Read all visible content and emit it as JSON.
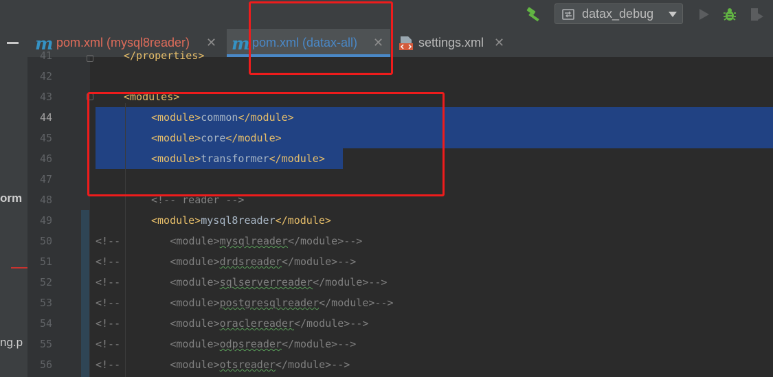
{
  "toolbar": {
    "run_config": {
      "label": "datax_debug"
    },
    "icons": [
      "hammer-icon",
      "config-icon",
      "chevron-down-icon",
      "run-icon",
      "debug-icon",
      "coverage-icon"
    ]
  },
  "side_panel": {
    "text_1": "orm",
    "text_2": "ng.p"
  },
  "tabs": [
    {
      "label": "pom.xml (mysql8reader)",
      "icon": "m-icon",
      "active": false,
      "color": "#e06c5a"
    },
    {
      "label": "pom.xml (datax-all)",
      "icon": "m-icon",
      "active": true,
      "color": "#4a88c7"
    },
    {
      "label": "settings.xml",
      "icon": "xml-file-icon",
      "active": false,
      "color": "#bbbbbb"
    }
  ],
  "editor": {
    "lines": [
      {
        "num": "41",
        "parts": [
          {
            "c": "tag",
            "t": "</properties>"
          }
        ]
      },
      {
        "num": "42",
        "parts": []
      },
      {
        "num": "43",
        "parts": [
          {
            "c": "tag",
            "t": "<modules>"
          }
        ]
      },
      {
        "num": "44",
        "parts": [
          {
            "c": "tag",
            "t": "<module>"
          },
          {
            "c": "txt",
            "t": "common"
          },
          {
            "c": "tag",
            "t": "</module>"
          }
        ]
      },
      {
        "num": "45",
        "parts": [
          {
            "c": "tag",
            "t": "<module>"
          },
          {
            "c": "txt",
            "t": "core"
          },
          {
            "c": "tag",
            "t": "</module>"
          }
        ]
      },
      {
        "num": "46",
        "parts": [
          {
            "c": "tag",
            "t": "<module>"
          },
          {
            "c": "txt",
            "t": "transformer"
          },
          {
            "c": "tag",
            "t": "</module>"
          }
        ]
      },
      {
        "num": "47",
        "parts": []
      },
      {
        "num": "48",
        "parts": [
          {
            "c": "cmt",
            "t": "<!-- reader -->"
          }
        ]
      },
      {
        "num": "49",
        "parts": [
          {
            "c": "tag",
            "t": "<module>"
          },
          {
            "c": "txt",
            "t": "mysql8reader"
          },
          {
            "c": "tag",
            "t": "</module>"
          }
        ]
      },
      {
        "num": "50",
        "parts": [
          {
            "c": "cmt",
            "t": "<!--"
          },
          {
            "c": "pad",
            "t": "        "
          },
          {
            "c": "cmt",
            "t": "<module>"
          },
          {
            "c": "cmtu",
            "t": "mysqlreader"
          },
          {
            "c": "cmt",
            "t": "</module>-->"
          }
        ]
      },
      {
        "num": "51",
        "parts": [
          {
            "c": "cmt",
            "t": "<!--"
          },
          {
            "c": "pad",
            "t": "        "
          },
          {
            "c": "cmt",
            "t": "<module>"
          },
          {
            "c": "cmtu",
            "t": "drdsreader"
          },
          {
            "c": "cmt",
            "t": "</module>-->"
          }
        ]
      },
      {
        "num": "52",
        "parts": [
          {
            "c": "cmt",
            "t": "<!--"
          },
          {
            "c": "pad",
            "t": "        "
          },
          {
            "c": "cmt",
            "t": "<module>"
          },
          {
            "c": "cmtu",
            "t": "sqlserverreader"
          },
          {
            "c": "cmt",
            "t": "</module>-->"
          }
        ]
      },
      {
        "num": "53",
        "parts": [
          {
            "c": "cmt",
            "t": "<!--"
          },
          {
            "c": "pad",
            "t": "        "
          },
          {
            "c": "cmt",
            "t": "<module>"
          },
          {
            "c": "cmtu",
            "t": "postgresqlreader"
          },
          {
            "c": "cmt",
            "t": "</module>-->"
          }
        ]
      },
      {
        "num": "54",
        "parts": [
          {
            "c": "cmt",
            "t": "<!--"
          },
          {
            "c": "pad",
            "t": "        "
          },
          {
            "c": "cmt",
            "t": "<module>"
          },
          {
            "c": "cmtu",
            "t": "oraclereader"
          },
          {
            "c": "cmt",
            "t": "</module>-->"
          }
        ]
      },
      {
        "num": "55",
        "parts": [
          {
            "c": "cmt",
            "t": "<!--"
          },
          {
            "c": "pad",
            "t": "        "
          },
          {
            "c": "cmt",
            "t": "<module>"
          },
          {
            "c": "cmtu",
            "t": "odpsreader"
          },
          {
            "c": "cmt",
            "t": "</module>-->"
          }
        ]
      },
      {
        "num": "56",
        "parts": [
          {
            "c": "cmt",
            "t": "<!--"
          },
          {
            "c": "pad",
            "t": "        "
          },
          {
            "c": "cmt",
            "t": "<module>"
          },
          {
            "c": "cmtu",
            "t": "otsreader"
          },
          {
            "c": "cmt",
            "t": "</module>-->"
          }
        ]
      }
    ]
  },
  "colors": {
    "selection": "#214283",
    "annotation": "#ee1c1c"
  }
}
